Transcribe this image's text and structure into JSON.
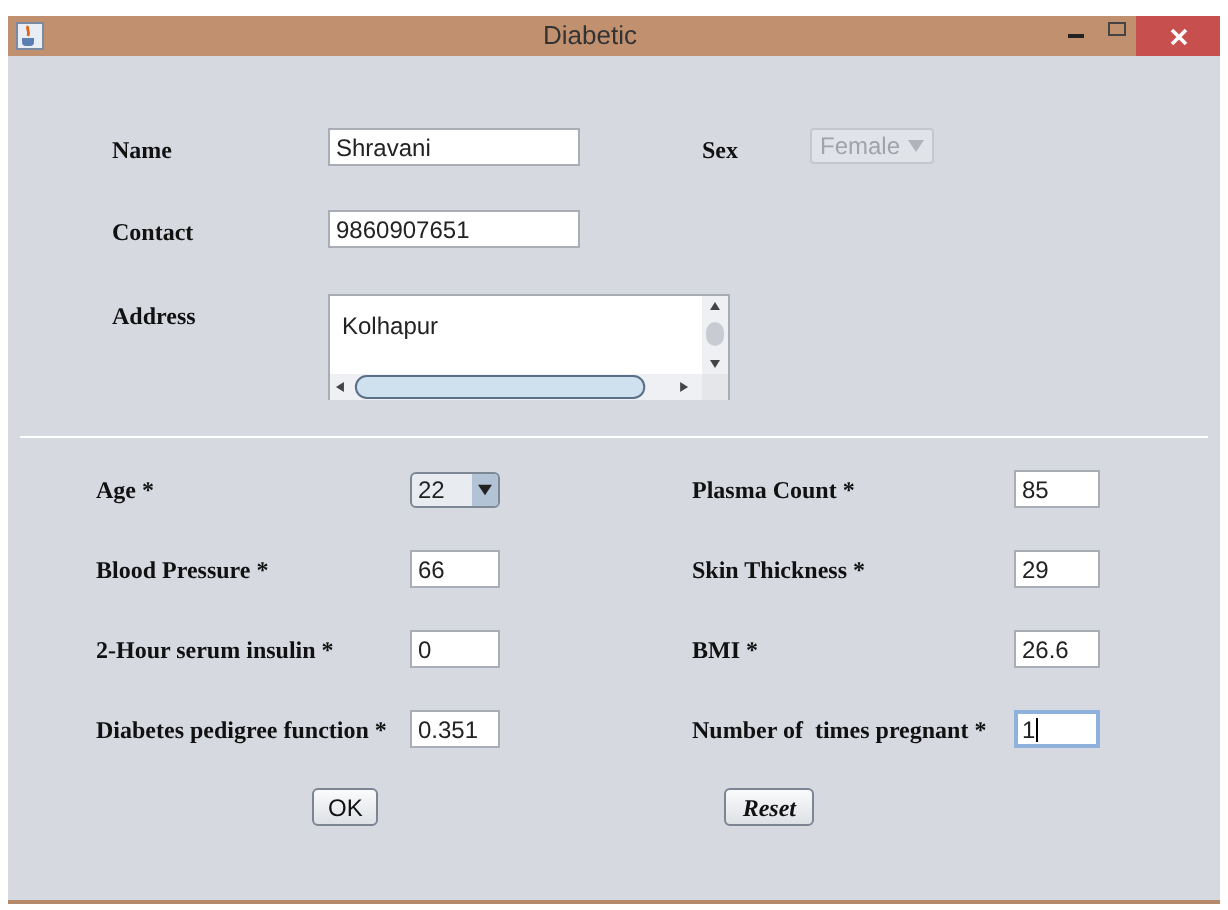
{
  "window": {
    "title": "Diabetic"
  },
  "personal": [
    {
      "label": "Name",
      "kind": "text",
      "value": "Shravani"
    },
    {
      "label": "Contact",
      "kind": "text",
      "value": "9860907651"
    },
    {
      "label": "Address",
      "kind": "textarea",
      "value": "Kolhapur"
    }
  ],
  "sex": {
    "label": "Sex",
    "value": "Female",
    "disabled": true
  },
  "measures": [
    {
      "label": "Age *",
      "kind": "combo",
      "value": "22",
      "focused": false
    },
    {
      "label": "Plasma Count *",
      "kind": "text",
      "value": "85",
      "focused": false
    },
    {
      "label": "Blood Pressure *",
      "kind": "text",
      "value": "66",
      "focused": false
    },
    {
      "label": "Skin Thickness *",
      "kind": "text",
      "value": "29",
      "focused": false
    },
    {
      "label": "2-Hour serum insulin *",
      "kind": "text",
      "value": "0",
      "focused": false
    },
    {
      "label": "BMI *",
      "kind": "text",
      "value": "26.6",
      "focused": false
    },
    {
      "label": "Diabetes pedigree function *",
      "kind": "text",
      "value": "0.351",
      "focused": false
    },
    {
      "label": "Number of  times pregnant *",
      "kind": "text",
      "value": "1",
      "focused": true
    }
  ],
  "buttons": [
    {
      "label": "OK",
      "italic": false
    },
    {
      "label": "Reset",
      "italic": true
    }
  ]
}
